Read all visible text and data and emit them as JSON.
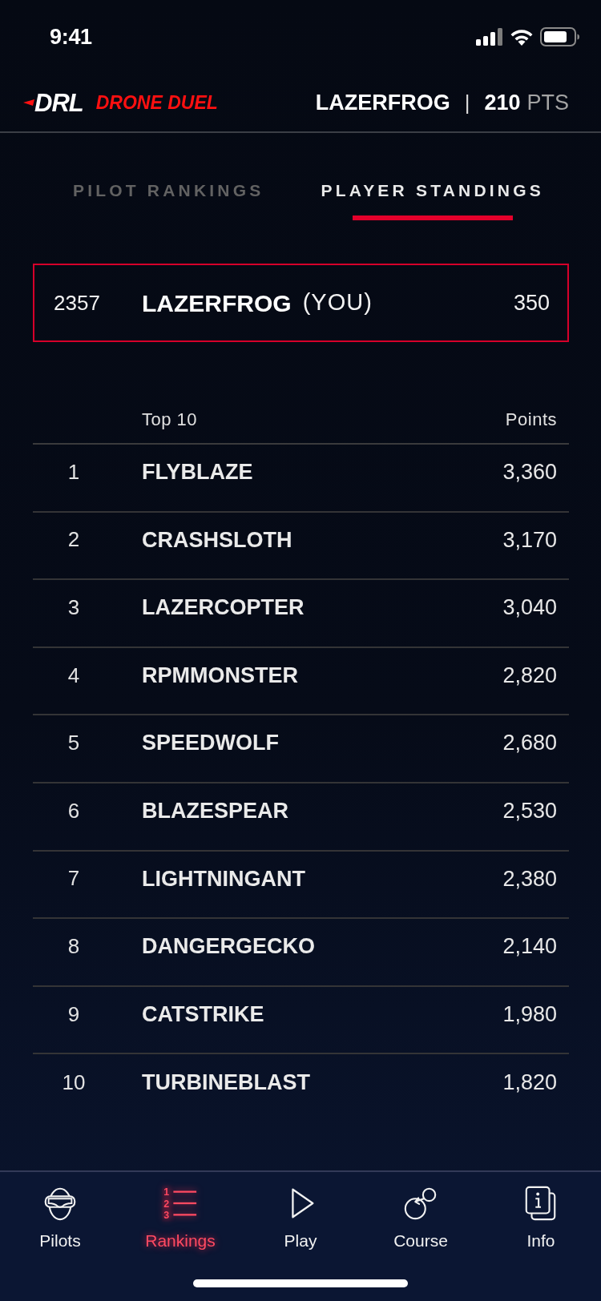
{
  "status_bar": {
    "time": "9:41"
  },
  "header": {
    "logo_mark": "DRL",
    "logo_text": "DRONE DUEL",
    "username": "LAZERFROG",
    "separator": "|",
    "points": "210",
    "points_unit": "PTS"
  },
  "tabs": [
    {
      "label": "PILOT RANKINGS",
      "selected": false
    },
    {
      "label": "PLAYER STANDINGS",
      "selected": true
    }
  ],
  "my_standing": {
    "rank": "2357",
    "name": "LAZERFROG",
    "tag": "(YOU)",
    "points": "350"
  },
  "table": {
    "columns": [
      "Top 10",
      "Points"
    ],
    "rows": [
      {
        "rank": "1",
        "name": "FLYBLAZE",
        "points": "3,360"
      },
      {
        "rank": "2",
        "name": "CRASHSLOTH",
        "points": "3,170"
      },
      {
        "rank": "3",
        "name": "LAZERCOPTER",
        "points": "3,040"
      },
      {
        "rank": "4",
        "name": "RPMMONSTER",
        "points": "2,820"
      },
      {
        "rank": "5",
        "name": "SPEEDWOLF",
        "points": "2,680"
      },
      {
        "rank": "6",
        "name": "BLAZESPEAR",
        "points": "2,530"
      },
      {
        "rank": "7",
        "name": "LIGHTNINGANT",
        "points": "2,380"
      },
      {
        "rank": "8",
        "name": "DANGERGECKO",
        "points": "2,140"
      },
      {
        "rank": "9",
        "name": "CATSTRIKE",
        "points": "1,980"
      },
      {
        "rank": "10",
        "name": "TURBINEBLAST",
        "points": "1,820"
      }
    ]
  },
  "bottom_nav": [
    {
      "label": "Pilots",
      "kind": "goggles",
      "selected": false
    },
    {
      "label": "Rankings",
      "kind": "numbered-list",
      "icon_marks": [
        "1",
        "2",
        "3"
      ],
      "selected": true
    },
    {
      "label": "Play",
      "kind": "play",
      "selected": false
    },
    {
      "label": "Course",
      "kind": "course",
      "selected": false
    },
    {
      "label": "Info",
      "kind": "info",
      "selected": false
    }
  ]
}
